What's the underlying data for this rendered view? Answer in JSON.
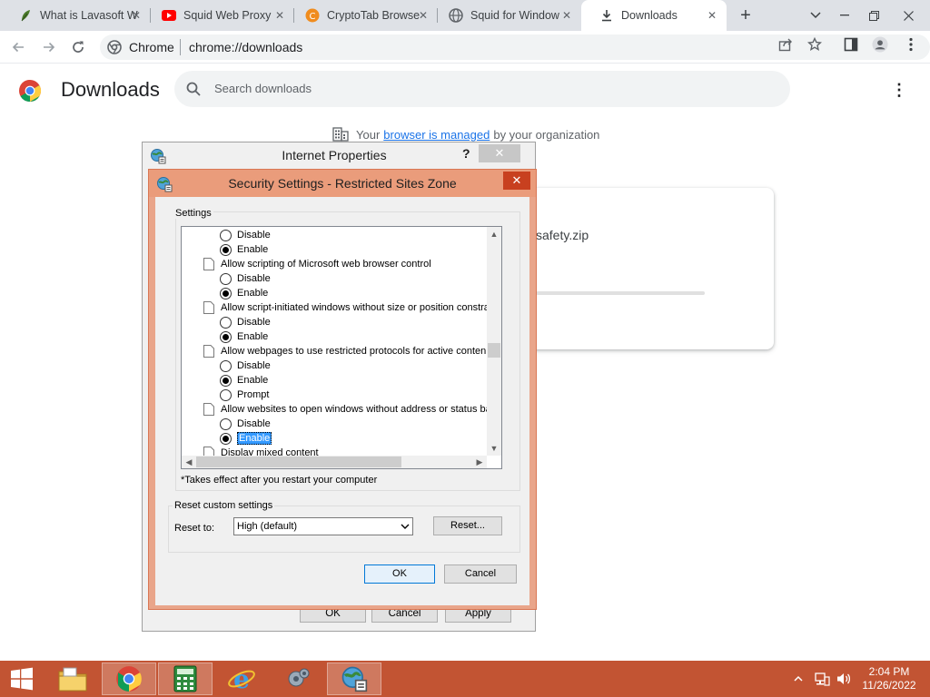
{
  "tabs": [
    {
      "title": "What is Lavasoft W",
      "icon": "leaf-icon",
      "active": false
    },
    {
      "title": "Squid Web Proxy",
      "icon": "youtube-icon",
      "active": false
    },
    {
      "title": "CryptoTab Browse",
      "icon": "cryptotab-icon",
      "active": false
    },
    {
      "title": "Squid for Window",
      "icon": "globe-icon",
      "active": false
    },
    {
      "title": "Downloads",
      "icon": "download-icon",
      "active": true
    }
  ],
  "omnibox": {
    "site_label": "Chrome",
    "url": "chrome://downloads"
  },
  "downloads": {
    "title": "Downloads",
    "search_placeholder": "Search downloads",
    "managed_prefix": "Your",
    "managed_link": "browser is managed",
    "managed_suffix": "by your organization",
    "file_name": "safety.zip"
  },
  "internet_properties": {
    "title": "Internet Properties",
    "help": "?",
    "ok": "OK",
    "cancel": "Cancel",
    "apply": "Apply"
  },
  "security_settings": {
    "title": "Security Settings - Restricted Sites Zone",
    "settings_label": "Settings",
    "tree": [
      {
        "type": "option",
        "label": "Disable",
        "checked": false
      },
      {
        "type": "option",
        "label": "Enable",
        "checked": true
      },
      {
        "type": "item",
        "label": "Allow scripting of Microsoft web browser control"
      },
      {
        "type": "option",
        "label": "Disable",
        "checked": false
      },
      {
        "type": "option",
        "label": "Enable",
        "checked": true
      },
      {
        "type": "item",
        "label": "Allow script-initiated windows without size or position constra"
      },
      {
        "type": "option",
        "label": "Disable",
        "checked": false
      },
      {
        "type": "option",
        "label": "Enable",
        "checked": true
      },
      {
        "type": "item",
        "label": "Allow webpages to use restricted protocols for active conten"
      },
      {
        "type": "option",
        "label": "Disable",
        "checked": false
      },
      {
        "type": "option",
        "label": "Enable",
        "checked": true
      },
      {
        "type": "option",
        "label": "Prompt",
        "checked": false
      },
      {
        "type": "item",
        "label": "Allow websites to open windows without address or status ba"
      },
      {
        "type": "option",
        "label": "Disable",
        "checked": false
      },
      {
        "type": "option",
        "label": "Enable",
        "checked": true,
        "selected": true
      },
      {
        "type": "item",
        "label": "Display mixed content"
      }
    ],
    "note": "*Takes effect after you restart your computer",
    "reset_group_label": "Reset custom settings",
    "reset_to_label": "Reset to:",
    "reset_to_value": "High (default)",
    "reset_button": "Reset...",
    "ok": "OK",
    "cancel": "Cancel"
  },
  "taskbar": {
    "apps": [
      "file-explorer-icon",
      "chrome-icon",
      "calculator-icon",
      "internet-explorer-icon",
      "settings-gear-icon",
      "internet-options-icon"
    ],
    "time": "2:04 PM",
    "date": "11/26/2022"
  },
  "colors": {
    "taskbar": "#c25433",
    "dialog_frame": "#e9a58a",
    "link": "#1a73e8"
  }
}
